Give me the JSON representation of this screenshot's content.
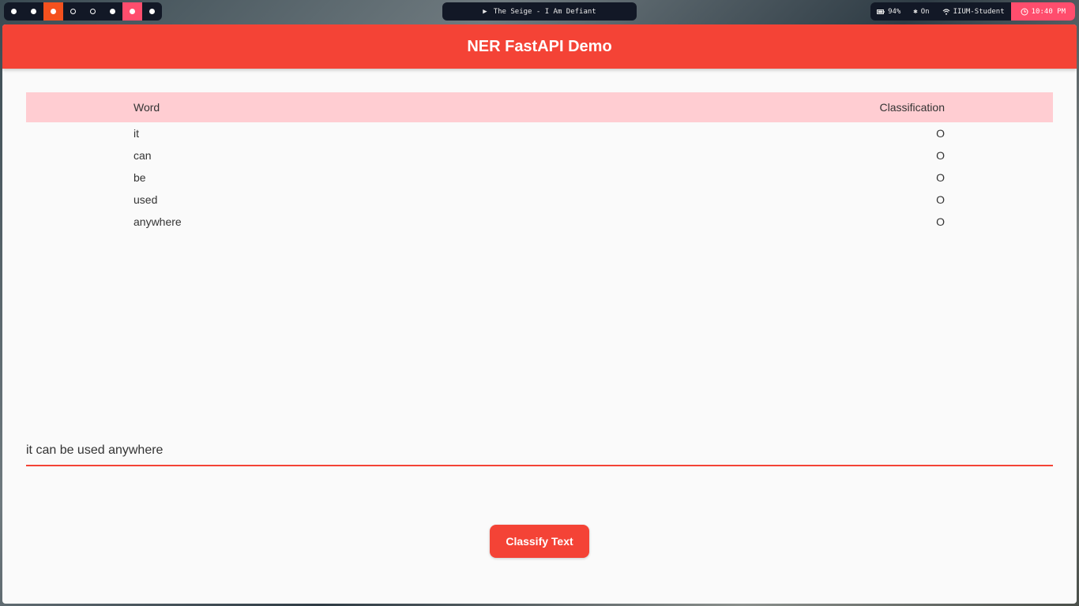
{
  "topbar": {
    "workspaces": [
      {
        "style": "filled",
        "state": "normal"
      },
      {
        "style": "filled",
        "state": "normal"
      },
      {
        "style": "filled",
        "state": "active"
      },
      {
        "style": "hollow",
        "state": "normal"
      },
      {
        "style": "hollow",
        "state": "normal"
      },
      {
        "style": "filled",
        "state": "normal"
      },
      {
        "style": "filled",
        "state": "urgent"
      },
      {
        "style": "filled",
        "state": "normal"
      }
    ],
    "media": {
      "icon": "play-icon",
      "track": "The Seige - I Am Defiant"
    },
    "battery": {
      "icon": "battery-icon",
      "value": "94%"
    },
    "bluetooth": {
      "icon": "bluetooth-icon",
      "value": "On"
    },
    "wifi": {
      "icon": "wifi-icon",
      "value": "IIUM-Student"
    },
    "clock": {
      "icon": "clock-icon",
      "value": "10:40 PM"
    },
    "colors": {
      "bar_bg": "#121826",
      "active_ws": "#f4511e",
      "urgent_ws": "#ff4d6d",
      "clock_bg": "#ff4d6d"
    }
  },
  "app": {
    "title": "NER FastAPI Demo",
    "colors": {
      "primary": "#f44336",
      "header_row": "#ffcdd2",
      "background": "#fafafa"
    },
    "table": {
      "headers": {
        "word": "Word",
        "classification": "Classification"
      },
      "rows": [
        {
          "word": "it",
          "classification": "O"
        },
        {
          "word": "can",
          "classification": "O"
        },
        {
          "word": "be",
          "classification": "O"
        },
        {
          "word": "used",
          "classification": "O"
        },
        {
          "word": "anywhere",
          "classification": "O"
        }
      ]
    },
    "input": {
      "value": "it can be used anywhere",
      "placeholder": ""
    },
    "button": {
      "label": "Classify Text"
    }
  }
}
